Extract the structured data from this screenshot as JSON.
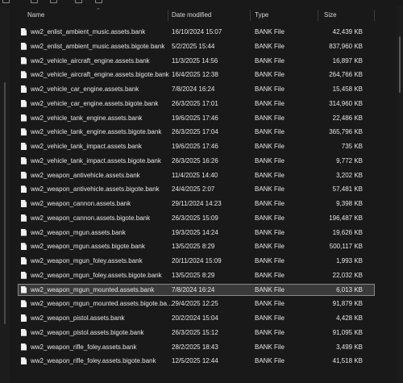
{
  "header": {
    "name": "Name",
    "date_modified": "Date modified",
    "type": "Type",
    "size": "Size",
    "sort_icon": "chevron-up-icon"
  },
  "files": [
    {
      "name": "ww2_enlist_ambient_music.assets.bank",
      "date": "16/10/2024 15:07",
      "type": "BANK File",
      "size": "42,439 KB"
    },
    {
      "name": "ww2_enlist_ambient_music.assets.bigote.bank",
      "date": "5/2/2025 15:44",
      "type": "BANK File",
      "size": "837,960 KB"
    },
    {
      "name": "ww2_vehicle_aircraft_engine.assets.bank",
      "date": "11/3/2025 14:56",
      "type": "BANK File",
      "size": "16,897 KB"
    },
    {
      "name": "ww2_vehicle_aircraft_engine.assets.bigote.bank",
      "date": "16/4/2025 12:38",
      "type": "BANK File",
      "size": "264,766 KB"
    },
    {
      "name": "ww2_vehicle_car_engine.assets.bank",
      "date": "7/8/2024 16:24",
      "type": "BANK File",
      "size": "15,458 KB"
    },
    {
      "name": "ww2_vehicle_car_engine.assets.bigote.bank",
      "date": "26/3/2025 17:01",
      "type": "BANK File",
      "size": "314,960 KB"
    },
    {
      "name": "ww2_vehicle_tank_engine.assets.bank",
      "date": "19/6/2025 17:46",
      "type": "BANK File",
      "size": "22,486 KB"
    },
    {
      "name": "ww2_vehicle_tank_engine.assets.bigote.bank",
      "date": "26/3/2025 17:04",
      "type": "BANK File",
      "size": "365,796 KB"
    },
    {
      "name": "ww2_vehicle_tank_impact.assets.bank",
      "date": "19/6/2025 17:46",
      "type": "BANK File",
      "size": "735 KB"
    },
    {
      "name": "ww2_vehicle_tank_impact.assets.bigote.bank",
      "date": "26/3/2025 16:26",
      "type": "BANK File",
      "size": "9,772 KB"
    },
    {
      "name": "ww2_weapon_antivehicle.assets.bank",
      "date": "11/4/2025 14:40",
      "type": "BANK File",
      "size": "3,202 KB"
    },
    {
      "name": "ww2_weapon_antivehicle.assets.bigote.bank",
      "date": "24/4/2025 2:07",
      "type": "BANK File",
      "size": "57,481 KB"
    },
    {
      "name": "ww2_weapon_cannon.assets.bank",
      "date": "29/11/2024 14:23",
      "type": "BANK File",
      "size": "9,398 KB"
    },
    {
      "name": "ww2_weapon_cannon.assets.bigote.bank",
      "date": "26/3/2025 15:09",
      "type": "BANK File",
      "size": "196,487 KB"
    },
    {
      "name": "ww2_weapon_mgun.assets.bank",
      "date": "19/3/2025 14:24",
      "type": "BANK File",
      "size": "19,626 KB"
    },
    {
      "name": "ww2_weapon_mgun.assets.bigote.bank",
      "date": "13/5/2025 8:29",
      "type": "BANK File",
      "size": "500,117 KB"
    },
    {
      "name": "ww2_weapon_mgun_foley.assets.bank",
      "date": "20/11/2024 15:09",
      "type": "BANK File",
      "size": "1,993 KB"
    },
    {
      "name": "ww2_weapon_mgun_foley.assets.bigote.bank",
      "date": "13/5/2025 8:29",
      "type": "BANK File",
      "size": "22,032 KB"
    },
    {
      "name": "ww2_weapon_mgun_mounted.assets.bank",
      "date": "7/8/2024 16:24",
      "type": "BANK File",
      "size": "6,013 KB",
      "selected": true
    },
    {
      "name": "ww2_weapon_mgun_mounted.assets.bigote.ba...",
      "date": "29/4/2025 12:25",
      "type": "BANK File",
      "size": "91,879 KB"
    },
    {
      "name": "ww2_weapon_pistol.assets.bank",
      "date": "20/2/2024 15:04",
      "type": "BANK File",
      "size": "4,428 KB"
    },
    {
      "name": "ww2_weapon_pistol.assets.bigote.bank",
      "date": "26/3/2025 15:12",
      "type": "BANK File",
      "size": "91,095 KB"
    },
    {
      "name": "ww2_weapon_rifle_foley.assets.bank",
      "date": "28/2/2025 18:43",
      "type": "BANK File",
      "size": "3,499 KB"
    },
    {
      "name": "ww2_weapon_rifle_foley.assets.bigote.bank",
      "date": "12/5/2025 12:44",
      "type": "BANK File",
      "size": "41,518 KB"
    }
  ],
  "file_icon": "document-icon",
  "colors": {
    "background": "#191919",
    "selection": "#3a3a3a",
    "selection_border": "#8a8a8a",
    "text": "#e6e6e6"
  }
}
